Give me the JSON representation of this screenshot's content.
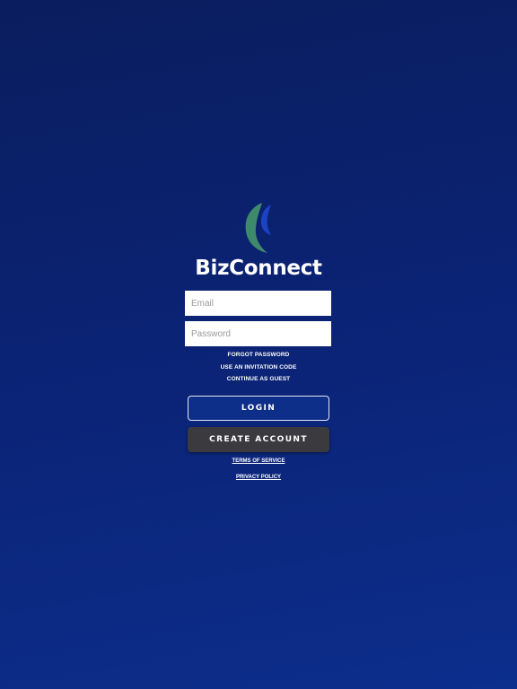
{
  "app": {
    "brand_name": "BizConnect",
    "logo_icon": "crescent-logo-icon",
    "colors": {
      "logo_green": "#3f8a6c",
      "logo_blue": "#1a44c2",
      "background": "#0b2478",
      "login_button": "#0d2f8a",
      "create_button": "#3b3b3f"
    }
  },
  "form": {
    "email_placeholder": "Email",
    "password_placeholder": "Password",
    "email_value": "",
    "password_value": ""
  },
  "links": {
    "forgot_password": "FORGOT PASSWORD",
    "invitation_code": "USE AN INVITATION CODE",
    "continue_guest": "CONTINUE AS GUEST"
  },
  "buttons": {
    "login": "LOGIN",
    "create_account": "CREATE ACCOUNT"
  },
  "legal": {
    "terms": "TERMS OF SERVICE",
    "privacy": "PRIVACY POLICY"
  }
}
